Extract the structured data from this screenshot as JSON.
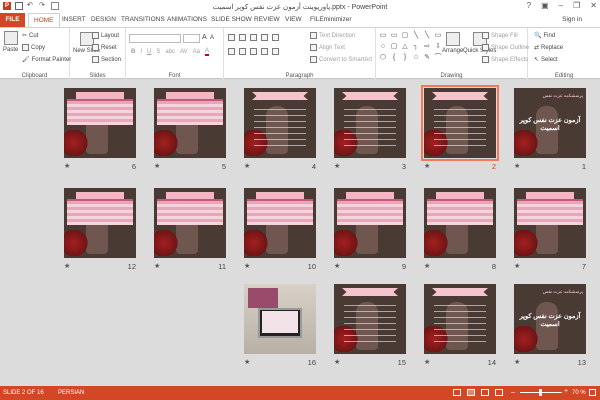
{
  "window": {
    "title": "پاورپوینت آزمون عزت نفس کوپر اسمیت.pptx - PowerPoint",
    "controls": [
      "?",
      "▣",
      "–",
      "❐",
      "✕"
    ]
  },
  "tabs": {
    "file": "FILE",
    "items": [
      "HOME",
      "INSERT",
      "DESIGN",
      "TRANSITIONS",
      "ANIMATIONS",
      "SLIDE SHOW",
      "REVIEW",
      "VIEW",
      "FILEminimizer"
    ],
    "active": "HOME",
    "sign_in": "Sign in"
  },
  "ribbon": {
    "clipboard": {
      "label": "Clipboard",
      "paste": "Paste",
      "cut": "Cut",
      "copy": "Copy",
      "format_painter": "Format Painter"
    },
    "slides": {
      "label": "Slides",
      "new_slide": "New Slide",
      "layout": "Layout",
      "reset": "Reset",
      "section": "Section"
    },
    "font": {
      "label": "Font",
      "buttons": [
        "B",
        "I",
        "U",
        "S",
        "abc",
        "AV",
        "Aa",
        "A"
      ]
    },
    "paragraph": {
      "label": "Paragraph",
      "text_direction": "Text Direction",
      "align_text": "Align Text",
      "convert_smartart": "Convert to SmartArt"
    },
    "drawing": {
      "label": "Drawing",
      "arrange": "Arrange",
      "quick_styles": "Quick Styles",
      "shape_fill": "Shape Fill",
      "shape_outline": "Shape Outline",
      "shape_effects": "Shape Effects",
      "shapes": [
        "▭",
        "▭",
        "▢",
        "╲",
        "╲",
        "▭",
        "○",
        "▢",
        "△",
        "┐",
        "⇨",
        "⇩",
        "⬡",
        "{",
        "}",
        "☆",
        "✎",
        "⌒"
      ]
    },
    "editing": {
      "label": "Editing",
      "find": "Find",
      "replace": "Replace",
      "select": "Select"
    }
  },
  "slides": [
    {
      "num": "1",
      "kind": "title",
      "title": "آزمون عزت نفس کوپر اسمیت",
      "subtitle": "پرسشنامه عزت نفس"
    },
    {
      "num": "2",
      "kind": "list",
      "selected": true
    },
    {
      "num": "3",
      "kind": "list"
    },
    {
      "num": "4",
      "kind": "list"
    },
    {
      "num": "5",
      "kind": "table"
    },
    {
      "num": "6",
      "kind": "table"
    },
    {
      "num": "7",
      "kind": "table"
    },
    {
      "num": "8",
      "kind": "table"
    },
    {
      "num": "9",
      "kind": "table"
    },
    {
      "num": "10",
      "kind": "table"
    },
    {
      "num": "11",
      "kind": "table"
    },
    {
      "num": "12",
      "kind": "table"
    },
    {
      "num": "13",
      "kind": "title",
      "title": "آزمون عزت نفس کوپر اسمیت",
      "subtitle": "پرسشنامه عزت نفس"
    },
    {
      "num": "14",
      "kind": "list"
    },
    {
      "num": "15",
      "kind": "list"
    },
    {
      "num": "16",
      "kind": "photo"
    }
  ],
  "star": "★",
  "status": {
    "slide_info": "SLIDE 2 OF 16",
    "language": "PERSIAN",
    "zoom": "70 %"
  },
  "colors": {
    "accent": "#d24726",
    "selection": "#f0795a"
  }
}
